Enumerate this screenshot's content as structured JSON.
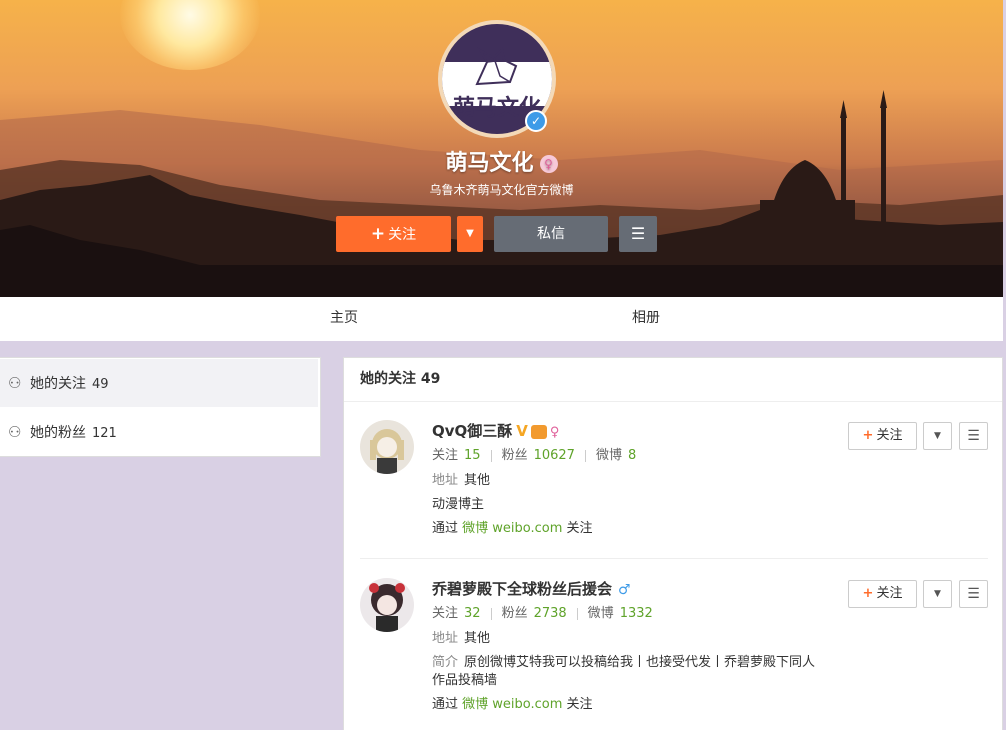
{
  "profile": {
    "avatar_text": "萌马文化",
    "name": "萌马文化",
    "gender_icon": "female-icon",
    "description": "乌鲁木齐萌马文化官方微博",
    "verified_icon": "verified-icon"
  },
  "actions": {
    "follow_label": "关注",
    "follow_plus": "+",
    "message_label": "私信",
    "more_icon": "menu-icon"
  },
  "tabs": [
    {
      "label": "主页"
    },
    {
      "label": "相册"
    }
  ],
  "sidebar": {
    "items": [
      {
        "label": "她的关注",
        "count": "49",
        "active": true
      },
      {
        "label": "她的粉丝",
        "count": "121",
        "active": false
      }
    ]
  },
  "main": {
    "title": "她的关注 49",
    "users": [
      {
        "name": "QvQ御三酥",
        "badges": [
          "V",
          "crown",
          "female"
        ],
        "stats": {
          "follow_label": "关注",
          "follow": "15",
          "fans_label": "粉丝",
          "fans": "10627",
          "weibo_label": "微博",
          "weibo": "8"
        },
        "address_label": "地址",
        "address": "其他",
        "bio": "动漫博主",
        "via_prefix": "通过",
        "via_link": "微博 weibo.com",
        "via_suffix": "关注",
        "follow_label": "关注"
      },
      {
        "name": "乔碧萝殿下全球粉丝后援会",
        "badges": [
          "male"
        ],
        "stats": {
          "follow_label": "关注",
          "follow": "32",
          "fans_label": "粉丝",
          "fans": "2738",
          "weibo_label": "微博",
          "weibo": "1332"
        },
        "address_label": "地址",
        "address": "其他",
        "intro_label": "简介",
        "intro": "原创微博艾特我可以投稿给我丨也接受代发丨乔碧萝殿下同人作品投稿墙",
        "via_prefix": "通过",
        "via_link": "微博 weibo.com",
        "via_suffix": "关注",
        "follow_label": "关注"
      }
    ]
  },
  "colors": {
    "accent_orange": "#ff6c2c",
    "gray_button": "#666c75",
    "link_green": "#5fa32a",
    "page_bg": "#d9d0e4"
  }
}
